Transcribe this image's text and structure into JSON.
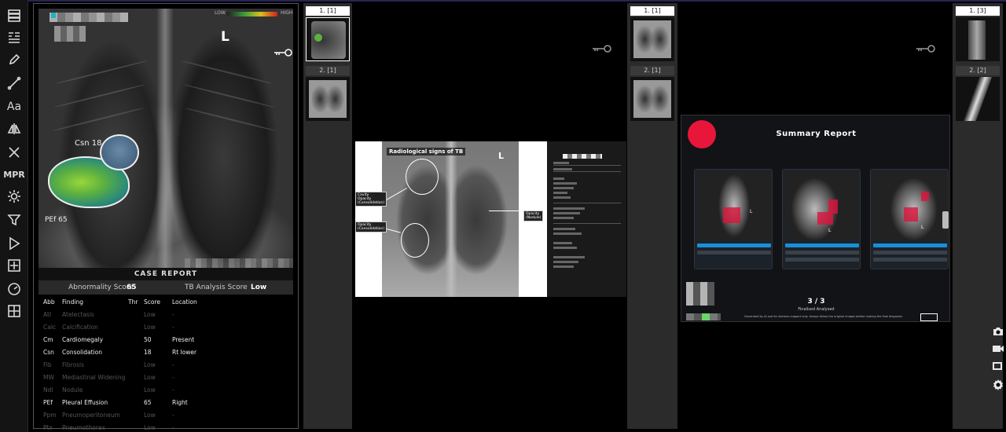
{
  "toolbar": {
    "items": [
      {
        "name": "layout-icon"
      },
      {
        "name": "list-icon"
      },
      {
        "name": "pen-icon"
      },
      {
        "name": "line-icon"
      },
      {
        "name": "text-icon",
        "label": "Aa"
      },
      {
        "name": "flip-icon"
      },
      {
        "name": "cross-icon"
      },
      {
        "name": "mpr-icon",
        "label": "MPR"
      },
      {
        "name": "brightness-icon"
      },
      {
        "name": "filter-icon"
      },
      {
        "name": "play-icon"
      },
      {
        "name": "crosshair-icon"
      },
      {
        "name": "gauge-icon"
      },
      {
        "name": "grid-icon"
      }
    ]
  },
  "viewport1": {
    "orientation": "L",
    "colorbar": {
      "low": "LOW",
      "high": "HIGH"
    },
    "annotations": {
      "csn": "Csn 18",
      "pef": "PEf 65"
    },
    "case_report": "CASE REPORT",
    "abnormality_label": "Abnormality Score",
    "abnormality_value": "65",
    "tb_label": "TB Analysis Score",
    "tb_value": "Low",
    "table": {
      "headers": {
        "abb": "Abb",
        "finding": "Finding",
        "thr": "Thr",
        "score": "Score",
        "location": "Location"
      },
      "rows": [
        {
          "abb": "Atl",
          "finding": "Atelectasis",
          "score": "Low",
          "location": "-",
          "active": false
        },
        {
          "abb": "Calc",
          "finding": "Calcification",
          "score": "Low",
          "location": "-",
          "active": false
        },
        {
          "abb": "Cm",
          "finding": "Cardiomegaly",
          "score": "50",
          "location": "Present",
          "active": true
        },
        {
          "abb": "Csn",
          "finding": "Consolidation",
          "score": "18",
          "location": "Rt lower",
          "active": true
        },
        {
          "abb": "Fib",
          "finding": "Fibrosis",
          "score": "Low",
          "location": "-",
          "active": false
        },
        {
          "abb": "MW",
          "finding": "Mediastinal Widening",
          "score": "Low",
          "location": "-",
          "active": false
        },
        {
          "abb": "Ndl",
          "finding": "Nodule",
          "score": "Low",
          "location": "-",
          "active": false
        },
        {
          "abb": "PEf",
          "finding": "Pleural Effusion",
          "score": "65",
          "location": "Right",
          "active": true
        },
        {
          "abb": "Ppm",
          "finding": "Pneumoperitoneum",
          "score": "Low",
          "location": "-",
          "active": false
        },
        {
          "abb": "Ptx",
          "finding": "Pneumothorax",
          "score": "Low",
          "location": "-",
          "active": false
        }
      ]
    }
  },
  "strip1": {
    "thumbs": [
      {
        "label": "1. [1]",
        "active": true
      },
      {
        "label": "2. [1]",
        "active": false
      }
    ]
  },
  "viewport2": {
    "title": "Radiological signs of TB",
    "orientation": "L",
    "labels": {
      "upper": "Cavity\nOpacity\n(Consolidation)",
      "lower": "Opacity\n(Consolidation)",
      "right": "Opacity\n(Nodule)"
    }
  },
  "strip2": {
    "thumbs": [
      {
        "label": "1. [1]",
        "active": true
      },
      {
        "label": "2. [1]",
        "active": false
      }
    ]
  },
  "viewport3": {
    "title": "Summary Report",
    "page": "3 / 3",
    "subtitle": "Finalised Analysed",
    "footer": "Generated by AI and for decision support only. Always follow the original images before making the final diagnosis.",
    "orientation": "L",
    "accent": "#e8163a"
  },
  "strip3": {
    "thumbs": [
      {
        "label": "1. [3]",
        "active": true
      },
      {
        "label": "2. [2]",
        "active": false
      }
    ]
  },
  "right_tools": [
    {
      "name": "camera-icon"
    },
    {
      "name": "video-icon"
    },
    {
      "name": "window-icon"
    },
    {
      "name": "gear-icon"
    }
  ]
}
